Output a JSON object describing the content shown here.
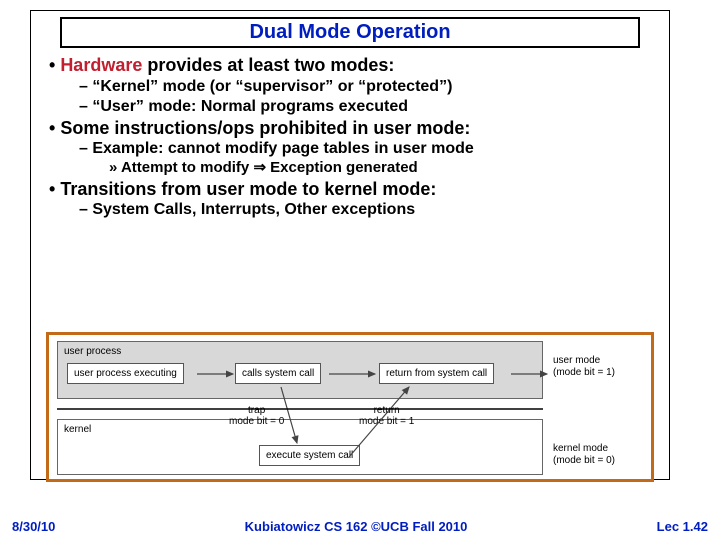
{
  "title": "Dual Mode Operation",
  "bullets": {
    "hw": "provides at least two modes:",
    "hw_accent": "Hardware ",
    "kernel_mode": "“Kernel” mode (or “supervisor” or “protected”)",
    "user_mode": "“User” mode: Normal programs executed",
    "prohibited": "Some instructions/ops prohibited in user mode:",
    "example": "Example: cannot modify page tables in user mode",
    "attempt": "Attempt to modify ⇒ Exception generated",
    "transitions": "Transitions from user mode to kernel mode:",
    "syscalls": "System Calls, Interrupts, Other exceptions"
  },
  "diagram": {
    "user_process": "user process",
    "executing": "user process executing",
    "calls": "calls system call",
    "return_from": "return from system call",
    "user_mode_label": "user mode",
    "user_mode_bit": "(mode bit = 1)",
    "kernel": "kernel",
    "trap": "trap",
    "trap_bit": "mode bit = 0",
    "return": "return",
    "return_bit": "mode bit = 1",
    "execute": "execute system call",
    "kernel_mode_label": "kernel mode",
    "kernel_mode_bit": "(mode bit = 0)"
  },
  "footer": {
    "date": "8/30/10",
    "course": "Kubiatowicz CS 162 ©UCB Fall 2010",
    "page": "Lec 1.42"
  }
}
